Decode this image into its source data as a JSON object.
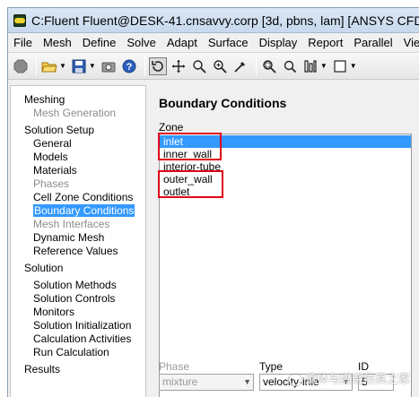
{
  "window": {
    "title": "C:Fluent Fluent@DESK-41.cnsavvy.corp  [3d, pbns, lam] [ANSYS CFD]"
  },
  "menubar": {
    "items": [
      "File",
      "Mesh",
      "Define",
      "Solve",
      "Adapt",
      "Surface",
      "Display",
      "Report",
      "Parallel",
      "Vie"
    ]
  },
  "toolbar": {
    "icons": [
      "stop-icon",
      "open-folder-icon",
      "save-disk-icon",
      "camera-icon",
      "help-icon",
      "rotate-icon",
      "move-icon",
      "zoom-icon",
      "zoom-in-icon",
      "probe-icon",
      "zoom-fit-icon",
      "zoom-box-icon",
      "model-layout-icon",
      "window-icon"
    ]
  },
  "tree": {
    "items": [
      {
        "label": "Meshing",
        "level": 1,
        "state": "normal"
      },
      {
        "label": "Mesh Generation",
        "level": 2,
        "state": "disabled"
      },
      {
        "label": "Solution Setup",
        "level": 1,
        "state": "normal"
      },
      {
        "label": "General",
        "level": 2,
        "state": "normal"
      },
      {
        "label": "Models",
        "level": 2,
        "state": "normal"
      },
      {
        "label": "Materials",
        "level": 2,
        "state": "normal"
      },
      {
        "label": "Phases",
        "level": 2,
        "state": "disabled"
      },
      {
        "label": "Cell Zone Conditions",
        "level": 2,
        "state": "normal"
      },
      {
        "label": "Boundary Conditions",
        "level": 2,
        "state": "selected"
      },
      {
        "label": "Mesh Interfaces",
        "level": 2,
        "state": "disabled"
      },
      {
        "label": "Dynamic Mesh",
        "level": 2,
        "state": "normal"
      },
      {
        "label": "Reference Values",
        "level": 2,
        "state": "normal"
      },
      {
        "label": "Solution",
        "level": 1,
        "state": "normal"
      },
      {
        "label": "Solution Methods",
        "level": 2,
        "state": "normal"
      },
      {
        "label": "Solution Controls",
        "level": 2,
        "state": "normal"
      },
      {
        "label": "Monitors",
        "level": 2,
        "state": "normal"
      },
      {
        "label": "Solution Initialization",
        "level": 2,
        "state": "normal"
      },
      {
        "label": "Calculation Activities",
        "level": 2,
        "state": "normal"
      },
      {
        "label": "Run Calculation",
        "level": 2,
        "state": "normal"
      },
      {
        "label": "Results",
        "level": 1,
        "state": "normal"
      }
    ]
  },
  "panel": {
    "title": "Boundary Conditions",
    "zone_label": "Zone",
    "zones": [
      "inlet",
      "inner_wall",
      "interior-tube",
      "outer_wall",
      "outlet"
    ],
    "selected_zone": "inlet",
    "phase_label": "Phase",
    "phase_value": "mixture",
    "type_label": "Type",
    "type_value": "velocity-inle",
    "id_label": "ID",
    "id_value": "5"
  },
  "annotation_color": "#e0001a",
  "selection_color": "#3399ff",
  "watermark": "流体与燃烧仿真之家"
}
